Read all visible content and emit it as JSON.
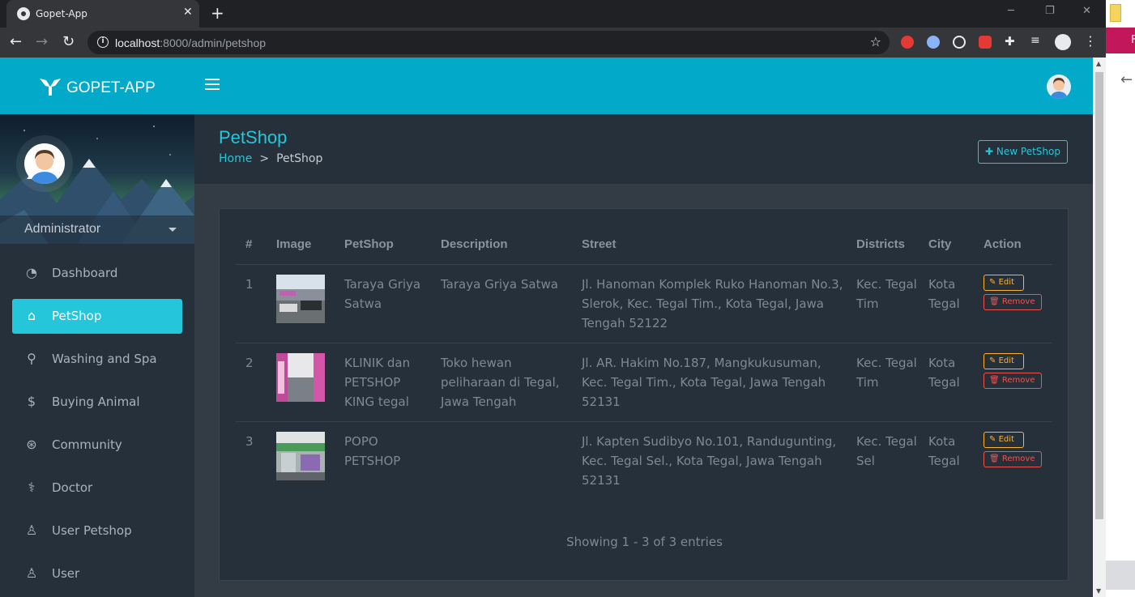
{
  "browser": {
    "tab_title": "Gopet-App",
    "tab_close": "✕",
    "new_tab": "+",
    "url_host": "localhost",
    "url_path": ":8000/admin/petshop",
    "window_min": "─",
    "window_max": "❐",
    "window_close": "✕"
  },
  "app": {
    "logo_text": "GOPET-APP",
    "user_name": "Administrator"
  },
  "sidebar": {
    "items": [
      {
        "label": "Dashboard",
        "icon": "dashboard-icon"
      },
      {
        "label": "PetShop",
        "icon": "home-icon"
      },
      {
        "label": "Washing and Spa",
        "icon": "shower-icon"
      },
      {
        "label": "Buying Animal",
        "icon": "dollar-icon"
      },
      {
        "label": "Community",
        "icon": "community-icon"
      },
      {
        "label": "Doctor",
        "icon": "doctor-icon"
      },
      {
        "label": "User Petshop",
        "icon": "user-icon"
      },
      {
        "label": "User",
        "icon": "user-icon"
      }
    ]
  },
  "page": {
    "title": "PetShop",
    "breadcrumb_home": "Home",
    "breadcrumb_sep": ">",
    "breadcrumb_current": "PetShop",
    "new_button": "New PetShop"
  },
  "table": {
    "headers": [
      "#",
      "Image",
      "PetShop",
      "Description",
      "Street",
      "Districts",
      "City",
      "Action"
    ],
    "rows": [
      {
        "no": "1",
        "name": "Taraya Griya Satwa",
        "description": "Taraya Griya Satwa",
        "street": "Jl. Hanoman Komplek Ruko Hanoman No.3, Slerok, Kec. Tegal Tim., Kota Tegal, Jawa Tengah 52122",
        "district": "Kec. Tegal Tim",
        "city": "Kota Tegal"
      },
      {
        "no": "2",
        "name": "KLINIK dan PETSHOP KING tegal",
        "description": "Toko hewan peliharaan di Tegal, Jawa Tengah",
        "street": "Jl. AR. Hakim No.187, Mangkukusuman, Kec. Tegal Tim., Kota Tegal, Jawa Tengah 52131",
        "district": "Kec. Tegal Tim",
        "city": "Kota Tegal"
      },
      {
        "no": "3",
        "name": "POPO PETSHOP",
        "description": "",
        "street": "Jl. Kapten Sudibyo No.101, Randugunting, Kec. Tegal Sel., Kota Tegal, Jawa Tengah 52131",
        "district": "Kec. Tegal Sel",
        "city": "Kota Tegal"
      }
    ],
    "edit_label": "Edit",
    "remove_label": "Remove",
    "footer": "Showing 1 - 3 of 3 entries"
  },
  "colors": {
    "accent": "#26c6da",
    "topbar": "#03a9c8",
    "edit": "#ffb22b",
    "remove": "#ef5350"
  }
}
